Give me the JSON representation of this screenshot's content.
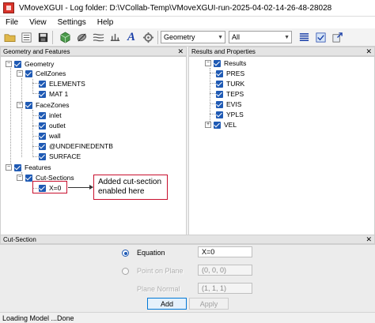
{
  "window": {
    "title": "VMoveXGUI - Log folder: D:\\VCollab-Temp\\VMoveXGUI-run-2025-04-02-14-26-48-28028"
  },
  "menu": [
    "File",
    "View",
    "Settings",
    "Help"
  ],
  "toolbar": {
    "filter_combo": "Geometry",
    "scope_combo": "All",
    "italic_a": "A"
  },
  "left_panel": {
    "title": "Geometry and Features",
    "close": "✕",
    "nodes": {
      "geometry": "Geometry",
      "cellzones": "CellZones",
      "elements": "ELEMENTS",
      "mat1": "MAT 1",
      "facezones": "FaceZones",
      "inlet": "inlet",
      "outlet": "outlet",
      "wall": "wall",
      "undefinedentb": "@UNDEFINEDENTB",
      "surface": "SURFACE",
      "features": "Features",
      "cutsections": "Cut-Sections",
      "x0": "X=0"
    }
  },
  "right_panel": {
    "title": "Results and Properties",
    "close": "✕",
    "nodes": {
      "results": "Results",
      "pres": "PRES",
      "turk": "TURK",
      "teps": "TEPS",
      "evis": "EVIS",
      "ypls": "YPLS",
      "vel": "VEL"
    }
  },
  "annotation": {
    "callout_text": "Added cut-section enabled here"
  },
  "cut_section": {
    "title": "Cut-Section",
    "close": "✕",
    "equation_label": "Equation",
    "equation_value": "X=0",
    "point_label": "Point on Plane",
    "point_value": "(0, 0, 0)",
    "normal_label": "Plane Normal",
    "normal_value": "(1, 1, 1)",
    "add_label": "Add",
    "apply_label": "Apply"
  },
  "status": {
    "text": "Loading Model ...Done"
  },
  "colors": {
    "accent": "#1f5ab4",
    "highlight": "#c8102e"
  }
}
